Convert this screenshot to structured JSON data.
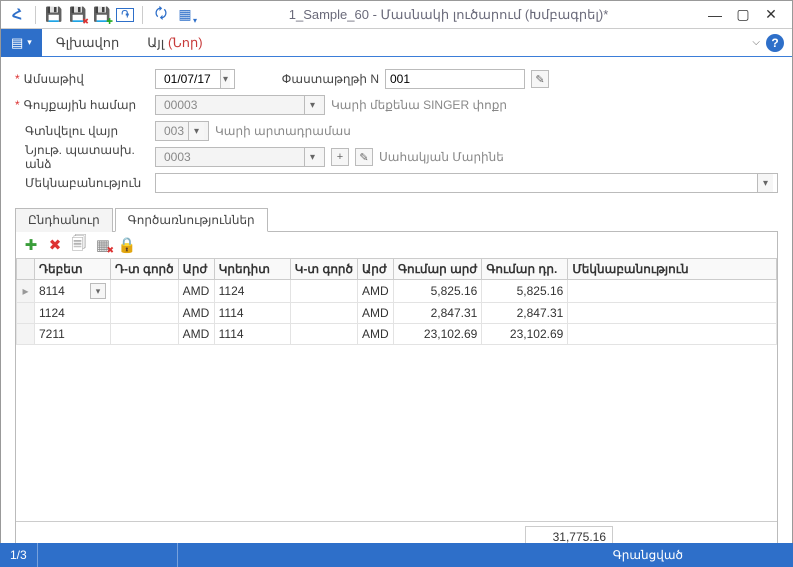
{
  "window": {
    "title": "1_Sample_60 - Մասնակի լուծարում (Խմբագրել)*"
  },
  "menu": {
    "main": "Գլխավոր",
    "other": "Այլ",
    "newTag": "(Նոր)"
  },
  "form": {
    "date": {
      "label": "Ամսաթիվ",
      "value": "01/07/17"
    },
    "docnum": {
      "label": "Փաստաթղթի N",
      "value": "001"
    },
    "invnum": {
      "label": "Գույքային համար",
      "value": "00003",
      "desc": "Կարի մեքենա SINGER փոքր"
    },
    "location": {
      "label": "Գտնվելու վայր",
      "value": "003",
      "desc": "Կարի արտադրամաս"
    },
    "resp": {
      "label": "Նյութ. պատասխ. անձ",
      "value": "0003",
      "desc": "Սահակյան Մարինե"
    },
    "comment": {
      "label": "Մեկնաբանություն",
      "value": ""
    }
  },
  "tabs": {
    "general": "Ընդհանուր",
    "entries": "Գործառնություններ"
  },
  "grid": {
    "headers": {
      "debit": "Դեբետ",
      "dcoef": "Դ-տ գործ",
      "dcur": "Արժ",
      "credit": "Կրեդիտ",
      "ccoef": "Կ-տ գործ",
      "ccur": "Արժ",
      "amtCur": "Գումար արժ",
      "amtDram": "Գումար դր.",
      "note": "Մեկնաբանություն"
    },
    "rows": [
      {
        "debit": "8114",
        "dcur": "AMD",
        "credit": "1124",
        "ccur": "AMD",
        "amtCur": "5,825.16",
        "amtDram": "5,825.16",
        "selected": true
      },
      {
        "debit": "1124",
        "dcur": "AMD",
        "credit": "1114",
        "ccur": "AMD",
        "amtCur": "2,847.31",
        "amtDram": "2,847.31"
      },
      {
        "debit": "7211",
        "dcur": "AMD",
        "credit": "1114",
        "ccur": "AMD",
        "amtCur": "23,102.69",
        "amtDram": "23,102.69"
      }
    ],
    "total": "31,775.16"
  },
  "status": {
    "page": "1/3",
    "state": "Գրանցված"
  }
}
